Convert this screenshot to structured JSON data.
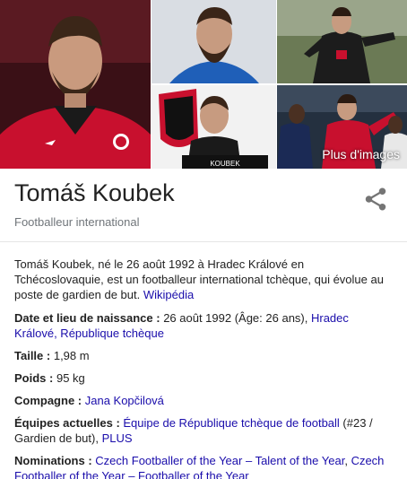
{
  "header": {
    "title": "Tomáš Koubek",
    "subtitle": "Footballeur international"
  },
  "images": {
    "more_label": "Plus d'images",
    "logo_text": "KOUBEK"
  },
  "description": {
    "text": "Tomáš Koubek, né le 26 août 1992 à Hradec Králové en Tchécoslovaquie, est un footballeur international tchèque, qui évolue au poste de gardien de but. ",
    "source_link": "Wikipédia"
  },
  "facts": {
    "birth": {
      "label": "Date et lieu de naissance",
      "sep": " : ",
      "value": "26 août 1992 (Âge: 26 ans), ",
      "link": "Hradec Králové, République tchèque"
    },
    "height": {
      "label": "Taille",
      "sep": " : ",
      "value": "1,98 m"
    },
    "weight": {
      "label": "Poids",
      "sep": " : ",
      "value": "95 kg"
    },
    "partner": {
      "label": "Compagne",
      "sep": " : ",
      "link": "Jana Kopčilová"
    },
    "teams": {
      "label": "Équipes actuelles",
      "sep": " : ",
      "link": "Équipe de République tchèque de football",
      "value": " (#23 / Gardien de but), ",
      "link2": "PLUS"
    },
    "nominations": {
      "label": "Nominations",
      "sep": " : ",
      "link": "Czech Footballer of the Year – Talent of the Year",
      "sep2": ", ",
      "link2": "Czech Footballer of the Year – Footballer of the Year"
    }
  },
  "colors": {
    "link": "#1a0dab",
    "subtitle": "#70757a",
    "jersey_red": "#c8102e"
  }
}
